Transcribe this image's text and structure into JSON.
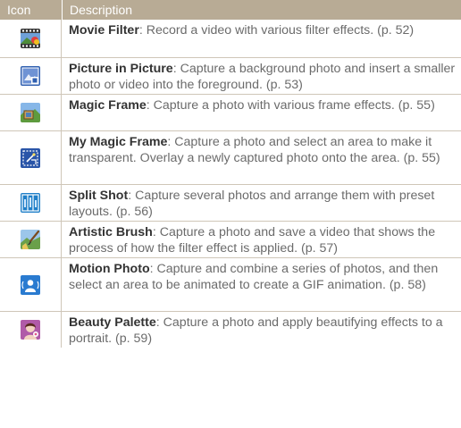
{
  "header": {
    "icon_col": "Icon",
    "desc_col": "Description"
  },
  "rows": [
    {
      "icon": "movie-filter-icon",
      "title": "Movie Filter",
      "desc": ": Record a video with various filter effects. (p. 52)"
    },
    {
      "icon": "picture-in-picture-icon",
      "title": "Picture in Picture",
      "desc": ": Capture a background photo and insert a smaller photo or video into the foreground. (p. 53)"
    },
    {
      "icon": "magic-frame-icon",
      "title": "Magic Frame",
      "desc": ": Capture a photo with various frame effects. (p. 55)"
    },
    {
      "icon": "my-magic-frame-icon",
      "title": "My Magic Frame",
      "desc": ": Capture a photo and select an area to make it transparent. Overlay a newly captured photo onto the area. (p. 55)"
    },
    {
      "icon": "split-shot-icon",
      "title": "Split Shot",
      "desc": ": Capture several photos and arrange them with preset layouts. (p. 56)"
    },
    {
      "icon": "artistic-brush-icon",
      "title": "Artistic Brush",
      "desc": ": Capture a photo and save a video that shows the process of how the filter effect is applied. (p. 57)"
    },
    {
      "icon": "motion-photo-icon",
      "title": "Motion Photo",
      "desc": ": Capture and combine a series of photos, and then select an area to be animated to create a GIF animation. (p. 58)"
    },
    {
      "icon": "beauty-palette-icon",
      "title": "Beauty Palette",
      "desc": ": Capture a photo and apply beautifying effects to a portrait. (p. 59)"
    }
  ]
}
